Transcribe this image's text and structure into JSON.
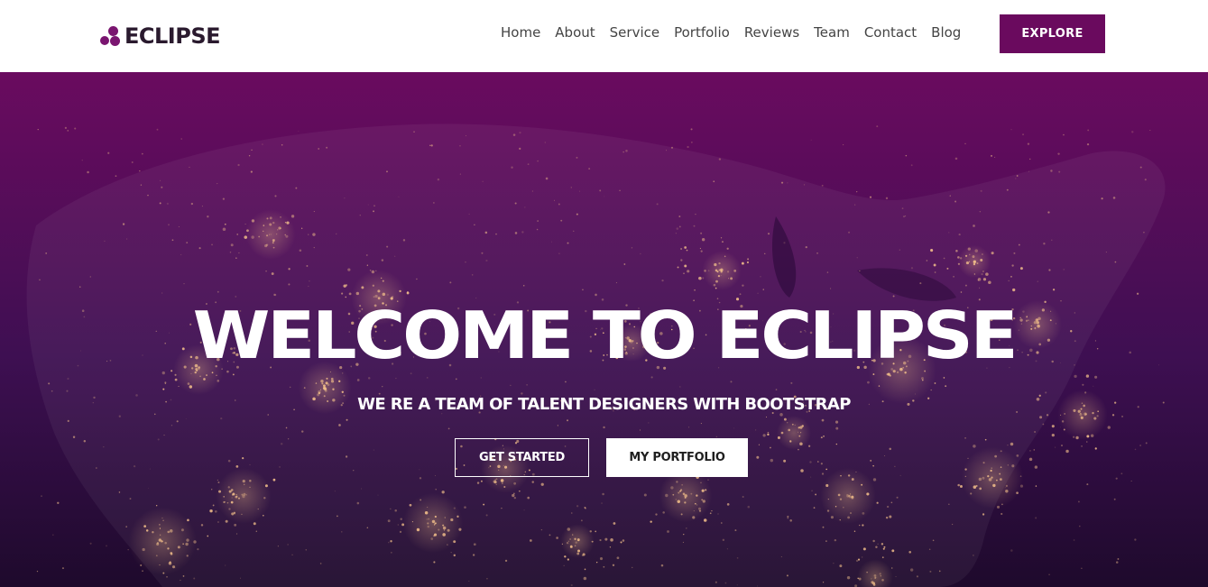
{
  "colors": {
    "brand": "#6a0a5e",
    "brand_dot": "#7a1570",
    "hero_top": "#6a0b5f",
    "hero_mid": "#3e0f52",
    "hero_bottom": "#1e0a2c",
    "city_lights": "#f3c08a"
  },
  "nav": {
    "brand_icon": "three-dots-logo-icon",
    "brand": "ECLIPSE",
    "links": [
      "Home",
      "About",
      "Service",
      "Portfolio",
      "Reviews",
      "Team",
      "Contact",
      "Blog"
    ],
    "cta": "EXPLORE"
  },
  "hero": {
    "title": "WELCOME TO ECLIPSE",
    "subtitle": "WE RE A TEAM OF TALENT DESIGNERS WITH BOOTSTRAP",
    "primary_button": "GET STARTED",
    "secondary_button": "MY PORTFOLIO"
  }
}
